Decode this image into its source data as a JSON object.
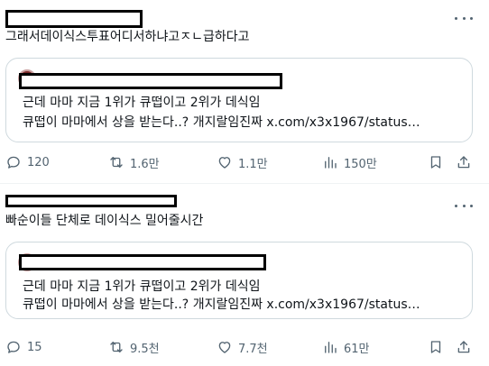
{
  "posts": [
    {
      "text": "그래서데이식스투표어디서하냐고ㅈㄴ급하다고",
      "quote": {
        "line1": "근데 마마 지금 1위가 큐떱이고 2위가 데식임",
        "line2": "큐떱이 마마에서 상을 받는다..? 개지랄임진짜 x.com/x3x1967/status…"
      },
      "stats": {
        "replies": "120",
        "reposts": "1.6만",
        "likes": "1.1만",
        "views": "150만"
      }
    },
    {
      "text": "빠순이들 단체로 데이식스 밀어줄시간",
      "quote": {
        "line1": "근데 마마 지금 1위가 큐떱이고 2위가 데식임",
        "line2": "큐떱이 마마에서 상을 받는다..? 개지랄임진짜 x.com/x3x1967/status…"
      },
      "stats": {
        "replies": "15",
        "reposts": "9.5천",
        "likes": "7.7천",
        "views": "61만"
      }
    }
  ],
  "icons": {
    "reply": "speech-bubble-icon",
    "repost": "repost-arrows-icon",
    "like": "heart-icon",
    "views": "bar-chart-icon",
    "bookmark": "bookmark-icon",
    "share": "share-upload-icon",
    "more": "three-dots-icon"
  }
}
